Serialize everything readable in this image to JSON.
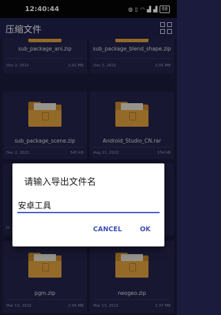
{
  "status_bar": {
    "time": "12:40:44",
    "indicators": [
      "notification-icon",
      "vibrate-icon",
      "wifi-icon",
      "signal-1-icon",
      "signal-2-icon"
    ],
    "battery": "68"
  },
  "app_bar": {
    "title": "压缩文件",
    "view_toggle_icon": "grid-view-icon"
  },
  "files": [
    {
      "name": "sub_package_ani.zip",
      "date": "Dec 2, 2021",
      "size": "2.02 MB"
    },
    {
      "name": "sub_package_blend_shape.zip",
      "date": "Dec 2, 2021",
      "size": "2.05 MB"
    },
    {
      "name": "sub_package_scene.zip",
      "date": "Dec 2, 2021",
      "size": "545 kB"
    },
    {
      "name": "Android_Studio_CN.rar",
      "date": "Aug 11, 2022",
      "size": "154 kB"
    },
    {
      "name": "",
      "date": "Ja",
      "size": ""
    },
    {
      "name": "",
      "date": "",
      "size": ""
    },
    {
      "name": "pgm.zip",
      "date": "Mar 13, 2022",
      "size": "2.58 MB"
    },
    {
      "name": "neogeo.zip",
      "date": "Mar 13, 2022",
      "size": "2.37 MB"
    }
  ],
  "dialog": {
    "title": "请输入导出文件名",
    "input_value": "安卓工具",
    "cancel_label": "CANCEL",
    "ok_label": "OK"
  },
  "colors": {
    "background": "#1b1b3d",
    "app_bar": "#21214d",
    "card": "#24244c",
    "folder": "#e3a33e",
    "accent": "#3f4fb8"
  }
}
